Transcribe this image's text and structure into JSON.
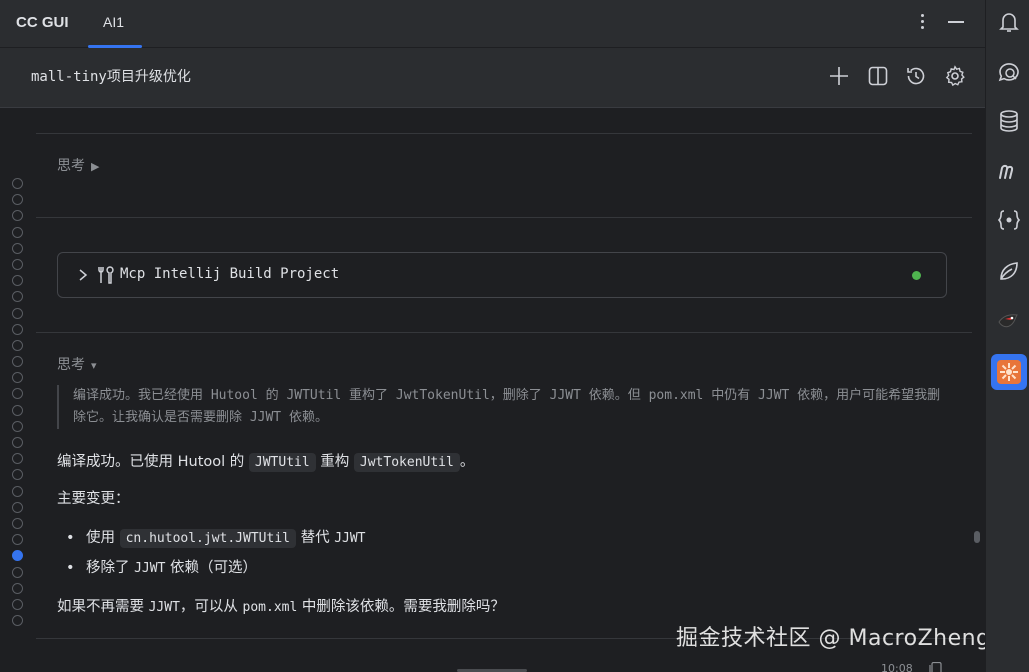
{
  "app": {
    "title": "CC GUI",
    "active_tab": "AI1"
  },
  "session": {
    "title": "mall-tiny项目升级优化"
  },
  "header_icons": [
    "plus-icon",
    "split-view-icon",
    "history-icon",
    "settings-icon"
  ],
  "sidebar_icons": [
    "bell-icon",
    "chat-icon",
    "database-icon",
    "m-icon",
    "json-icon",
    "leaf-icon",
    "bird-icon",
    "plugin-icon"
  ],
  "chat": {
    "think1": {
      "label": "思考",
      "toggle": "▶"
    },
    "tool": {
      "name": "Mcp Intellij Build Project",
      "status_color": "#4fb34f"
    },
    "think2": {
      "label": "思考",
      "toggle": "▾",
      "content": "编译成功。我已经使用 Hutool 的 JWTUtil 重构了 JwtTokenUtil，删除了 JJWT 依赖。但 pom.xml 中仍有 JJWT 依赖，用户可能希望我删除它。让我确认是否需要删除 JJWT 依赖。"
    },
    "summary": {
      "p1_a": "编译成功。已使用 Hutool 的 ",
      "p1_code1": "JWTUtil",
      "p1_b": " 重构 ",
      "p1_code2": "JwtTokenUtil",
      "p1_c": "。",
      "p2": "主要变更：",
      "li1_a": "使用 ",
      "li1_code": "cn.hutool.jwt.JWTUtil",
      "li1_b": " 替代 ",
      "li1_c": "JJWT",
      "li2_a": "移除了 ",
      "li2_b": "JJWT",
      "li2_c": " 依赖（可选）",
      "p3_a": "如果不再需要 ",
      "p3_b": "JJWT",
      "p3_c": "，可以从 ",
      "p3_d": "pom.xml",
      "p3_e": " 中删除该依赖。需要我删除吗？"
    },
    "timestamp": "10:08"
  },
  "watermark": "掘金技术社区 @ MacroZheng",
  "colors": {
    "accent": "#3574f0",
    "background": "#1e1f22",
    "panel": "#2b2d30"
  }
}
